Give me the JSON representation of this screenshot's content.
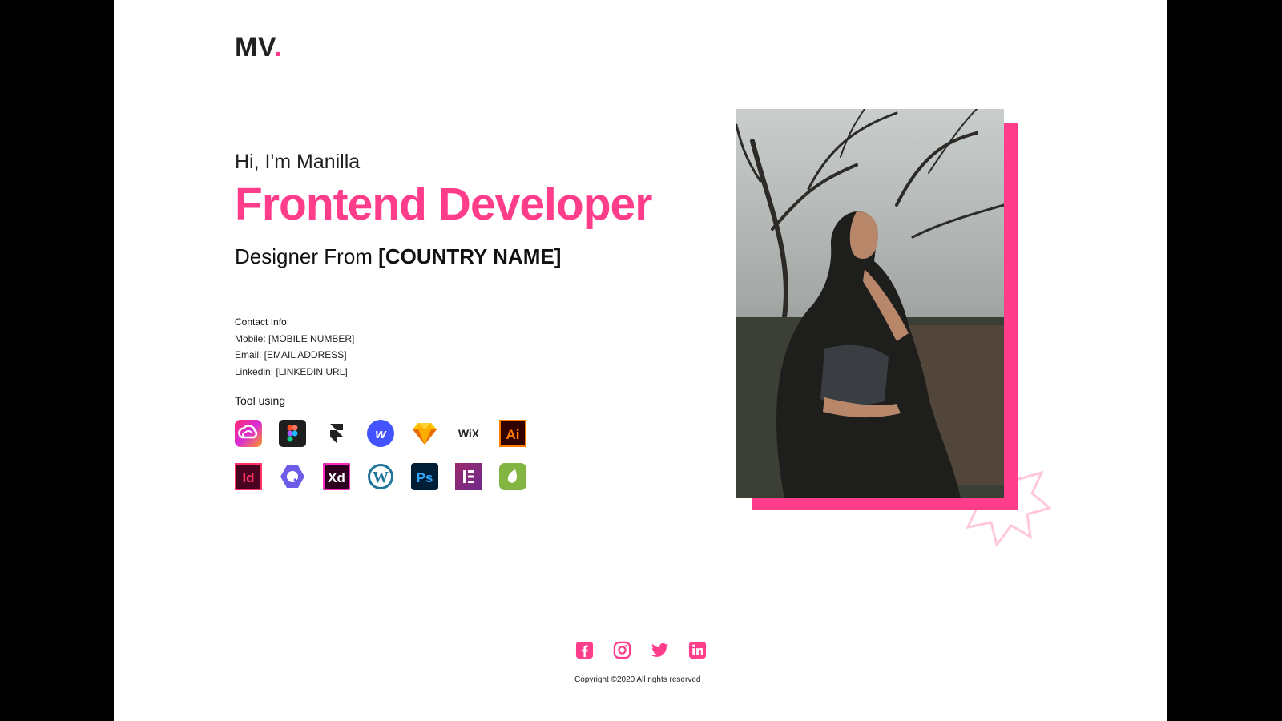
{
  "brand": {
    "logo_text": "MV",
    "logo_dot": ".",
    "accent_color": "#ff3d8b"
  },
  "hero": {
    "greeting": "Hi, I'm Manilla",
    "headline": "Frontend Developer",
    "subline_prefix": "Designer From ",
    "subline_country": "[COUNTRY NAME]"
  },
  "contact": {
    "title": "Contact Info:",
    "mobile": "Mobile: [MOBILE NUMBER]",
    "email": "Email: [EMAIL ADDRESS]",
    "linkedin": "Linkedin: [LINKEDIN URL]"
  },
  "tools": {
    "title": "Tool using",
    "row1": [
      {
        "name": "adobe-creative-cloud-icon",
        "label": ""
      },
      {
        "name": "figma-icon",
        "label": ""
      },
      {
        "name": "framer-icon",
        "label": ""
      },
      {
        "name": "webflow-icon",
        "label": "w"
      },
      {
        "name": "sketch-icon",
        "label": ""
      },
      {
        "name": "wix-icon",
        "label": "WiX"
      },
      {
        "name": "illustrator-icon",
        "label": "Ai"
      }
    ],
    "row2": [
      {
        "name": "indesign-icon",
        "label": "Id"
      },
      {
        "name": "quant-icon",
        "label": ""
      },
      {
        "name": "adobe-xd-icon",
        "label": "Xd"
      },
      {
        "name": "wordpress-icon",
        "label": ""
      },
      {
        "name": "photoshop-icon",
        "label": "Ps"
      },
      {
        "name": "elementor-icon",
        "label": ""
      },
      {
        "name": "envato-icon",
        "label": ""
      }
    ]
  },
  "footer": {
    "socials": [
      "facebook-icon",
      "instagram-icon",
      "twitter-icon",
      "linkedin-icon"
    ],
    "copyright": "Copyright ©2020 All rights reserved"
  }
}
